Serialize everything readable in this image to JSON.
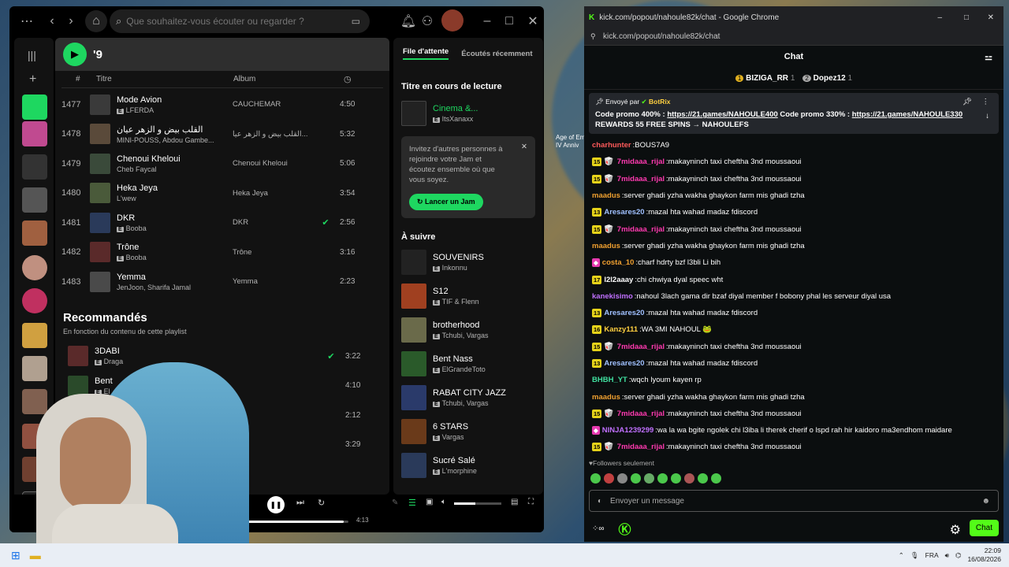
{
  "spotify": {
    "search_placeholder": "Que souhaitez-vous écouter ou regarder ?",
    "playlist_title": "'9",
    "col_number": "#",
    "col_title": "Titre",
    "col_album": "Album",
    "tracks": [
      {
        "n": "1477",
        "title": "Mode Avion",
        "artist": "LFERDA",
        "album": "CAUCHEMAR",
        "dur": "4:50",
        "explicit": true,
        "check": false,
        "color": "#3a3a3a"
      },
      {
        "n": "1478",
        "title": "القلب بيض و الزهر عيان",
        "artist": "MINI-POUSS, Abdou Gambe...",
        "album": "القلب بيض و الزهر عيا...",
        "dur": "5:32",
        "explicit": false,
        "check": false,
        "color": "#5a4a3a"
      },
      {
        "n": "1479",
        "title": "Chenoui Kheloui",
        "artist": "Cheb Faycal",
        "album": "Chenoui Kheloui",
        "dur": "5:06",
        "explicit": false,
        "check": false,
        "color": "#3a4a3a"
      },
      {
        "n": "1480",
        "title": "Heka Jeya",
        "artist": "L'wew",
        "album": "Heka Jeya",
        "dur": "3:54",
        "explicit": false,
        "check": false,
        "color": "#4a5a3a"
      },
      {
        "n": "1481",
        "title": "DKR",
        "artist": "Booba",
        "album": "DKR",
        "dur": "2:56",
        "explicit": true,
        "check": true,
        "color": "#2a3a5a"
      },
      {
        "n": "1482",
        "title": "Trône",
        "artist": "Booba",
        "album": "Trône",
        "dur": "3:16",
        "explicit": true,
        "check": false,
        "color": "#5a2a2a"
      },
      {
        "n": "1483",
        "title": "Yemma",
        "artist": "JenJoon, Sharifa Jamal",
        "album": "Yemma",
        "dur": "2:23",
        "explicit": false,
        "check": false,
        "color": "#4a4a4a"
      }
    ],
    "recommended_title": "Recommandés",
    "recommended_sub": "En fonction du contenu de cette playlist",
    "recommended": [
      {
        "title": "3DABI",
        "artist": "Draga",
        "dur": "3:22",
        "check": true,
        "color": "#5a2a2a"
      },
      {
        "title": "Bent",
        "artist": "El",
        "dur": "4:10",
        "check": false,
        "color": "#2a4a2a"
      },
      {
        "title": "",
        "artist": "",
        "dur": "2:12",
        "check": false,
        "color": "#444"
      },
      {
        "title": "",
        "artist": "",
        "dur": "3:29",
        "check": false,
        "color": "#444"
      }
    ],
    "queue_tab_active": "File d'attente",
    "queue_tab_recent": "Écoutés récemment",
    "now_playing_label": "Titre en cours de lecture",
    "now_playing": {
      "title": "Cinema &...",
      "artist": "ItsXanaxx"
    },
    "jam_text": "Invitez d'autres personnes à rejoindre votre Jam et écoutez ensemble où que vous soyez.",
    "jam_button": "Lancer un Jam",
    "next_label": "À suivre",
    "queue": [
      {
        "title": "SOUVENIRS",
        "artist": "Inkonnu",
        "color": "#222"
      },
      {
        "title": "S12",
        "artist": "TIF & Flenn",
        "color": "#a04020"
      },
      {
        "title": "brotherhood",
        "artist": "Tchubi, Vargas",
        "color": "#6a6a4a"
      },
      {
        "title": "Bent Nass",
        "artist": "ElGrandeToto",
        "color": "#2a5a2a"
      },
      {
        "title": "RABAT CITY JAZZ",
        "artist": "Tchubi, Vargas",
        "color": "#2a3a6a"
      },
      {
        "title": "6 STARS",
        "artist": "Vargas",
        "color": "#6a3a1a"
      },
      {
        "title": "Sucré Salé",
        "artist": "L'morphine",
        "color": "#2a3a5a"
      }
    ],
    "time_total": "4:13",
    "progress": 0.95
  },
  "chrome": {
    "title": "kick.com/popout/nahoule82k/chat - Google Chrome",
    "url": "kick.com/popout/nahoule82k/chat"
  },
  "chat": {
    "header": "Chat",
    "leader1": {
      "name": "BIZIGA_RR",
      "rank": "1",
      "count": "1"
    },
    "leader2": {
      "name": "Dopez12",
      "rank": "2",
      "count": "1"
    },
    "pin_sent_by": "Envoyé par",
    "pin_bot": "BotRix",
    "pin_text1": "Code promo 400% : ",
    "pin_link1": "https://21.games/NAHOULE400",
    "pin_text2": " Code promo 330% : ",
    "pin_link2": "https://21.games/NAHOULE330",
    "pin_text3": "REWARDS 55 FREE SPINS → NAHOULEFS",
    "messages": [
      {
        "badge": "",
        "emoji": "",
        "user": "charhunter",
        "color": "#ff5a5a",
        "text": "BOUS7A9"
      },
      {
        "badge": "15",
        "emoji": "🥡",
        "user": "7midaaa_rijal",
        "color": "#ff3ab0",
        "text": "makayninch taxi cheftha 3nd moussaoui"
      },
      {
        "badge": "15",
        "emoji": "🥡",
        "user": "7midaaa_rijal",
        "color": "#ff3ab0",
        "text": "makayninch taxi cheftha 3nd moussaoui"
      },
      {
        "badge": "",
        "emoji": "",
        "user": "maadus",
        "color": "#f0a030",
        "text": "server ghadi yzha wakha ghaykon farm mis ghadi tzha"
      },
      {
        "badge": "13",
        "emoji": "",
        "user": "Aresares20",
        "color": "#a0c0ff",
        "text": "mazal hta wahad madaz fdiscord"
      },
      {
        "badge": "15",
        "emoji": "🥡",
        "user": "7midaaa_rijal",
        "color": "#ff3ab0",
        "text": "makayninch taxi cheftha 3nd moussaoui"
      },
      {
        "badge": "",
        "emoji": "",
        "user": "maadus",
        "color": "#f0a030",
        "text": "server ghadi yzha wakha ghaykon farm mis ghadi tzha"
      },
      {
        "badge": "pink",
        "emoji": "",
        "user": "costa_10",
        "color": "#f0a030",
        "text": "charf hdrty bzf l3bli Li bih"
      },
      {
        "badge": "17",
        "emoji": "",
        "user": "l2l2aaay",
        "color": "#ffffff",
        "text": "chi chwiya dyal speec wht"
      },
      {
        "badge": "",
        "emoji": "",
        "user": "kanekisimo",
        "color": "#c070ff",
        "text": "nahoul 3lach gama dir bzaf diyal member f bobony phal les serveur diyal usa"
      },
      {
        "badge": "13",
        "emoji": "",
        "user": "Aresares20",
        "color": "#a0c0ff",
        "text": "mazal hta wahad madaz fdiscord"
      },
      {
        "badge": "16",
        "emoji": "",
        "user": "Kanzy111",
        "color": "#ffd040",
        "text": "WA 3MI NAHOUL 🐸"
      },
      {
        "badge": "15",
        "emoji": "🥡",
        "user": "7midaaa_rijal",
        "color": "#ff3ab0",
        "text": "makayninch taxi cheftha 3nd moussaoui"
      },
      {
        "badge": "13",
        "emoji": "",
        "user": "Aresares20",
        "color": "#a0c0ff",
        "text": "mazal hta wahad madaz fdiscord"
      },
      {
        "badge": "",
        "emoji": "",
        "user": "BHBH_YT",
        "color": "#40e0a0",
        "text": "wqch lyoum kayen rp"
      },
      {
        "badge": "",
        "emoji": "",
        "user": "maadus",
        "color": "#f0a030",
        "text": "server ghadi yzha wakha ghaykon farm mis ghadi tzha"
      },
      {
        "badge": "15",
        "emoji": "🥡",
        "user": "7midaaa_rijal",
        "color": "#ff3ab0",
        "text": "makayninch taxi cheftha 3nd moussaoui"
      },
      {
        "badge": "pink",
        "emoji": "",
        "user": "NINJA1239299",
        "color": "#c070ff",
        "text": "wa la wa bgite ngolek chi l3iba li therek cherif o lspd rah hir kaidoro ma3endhom maidare"
      },
      {
        "badge": "15",
        "emoji": "🥡",
        "user": "7midaaa_rijal",
        "color": "#ff3ab0",
        "text": "makayninch taxi cheftha 3nd moussaoui"
      }
    ],
    "followers_only": "Followers seulement",
    "send_placeholder": "Envoyer un message",
    "chat_button": "Chat"
  },
  "taskbar": {
    "lang": "FRA",
    "time": "22:09",
    "date": "16/08/2026"
  },
  "desktop_label": "Age of Em IV Anniv"
}
